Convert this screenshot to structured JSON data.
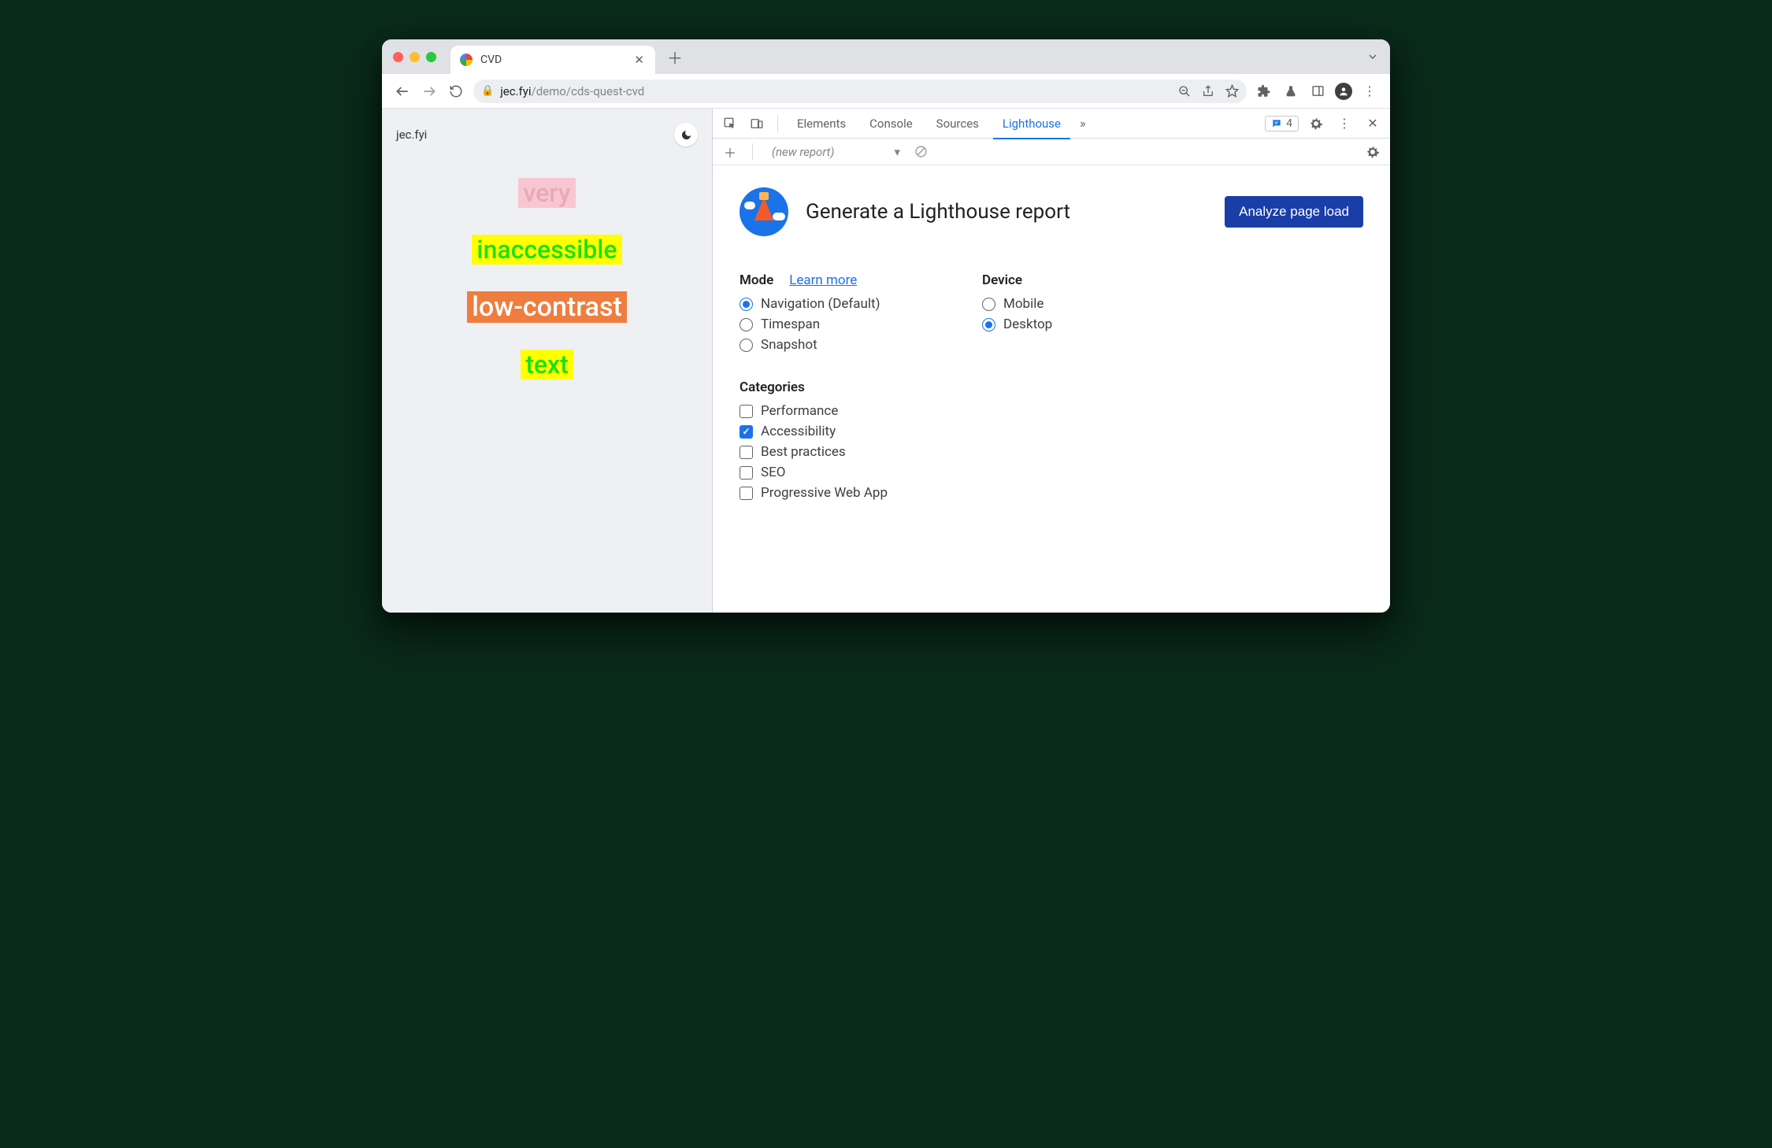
{
  "browser": {
    "tab_title": "CVD",
    "url_host": "jec.fyi",
    "url_path": "/demo/cds-quest-cvd"
  },
  "page": {
    "site_name": "jec.fyi",
    "words": [
      "very",
      "inaccessible",
      "low-contrast",
      "text"
    ]
  },
  "devtools": {
    "tabs": [
      "Elements",
      "Console",
      "Sources",
      "Lighthouse"
    ],
    "active_tab": "Lighthouse",
    "issues_count": "4",
    "report_dropdown": "(new report)"
  },
  "lighthouse": {
    "heading": "Generate a Lighthouse report",
    "analyze_button": "Analyze page load",
    "mode_label": "Mode",
    "learn_more": "Learn more",
    "modes": [
      {
        "label": "Navigation (Default)",
        "checked": true
      },
      {
        "label": "Timespan",
        "checked": false
      },
      {
        "label": "Snapshot",
        "checked": false
      }
    ],
    "device_label": "Device",
    "devices": [
      {
        "label": "Mobile",
        "checked": false
      },
      {
        "label": "Desktop",
        "checked": true
      }
    ],
    "categories_label": "Categories",
    "categories": [
      {
        "label": "Performance",
        "checked": false
      },
      {
        "label": "Accessibility",
        "checked": true
      },
      {
        "label": "Best practices",
        "checked": false
      },
      {
        "label": "SEO",
        "checked": false
      },
      {
        "label": "Progressive Web App",
        "checked": false
      }
    ]
  }
}
